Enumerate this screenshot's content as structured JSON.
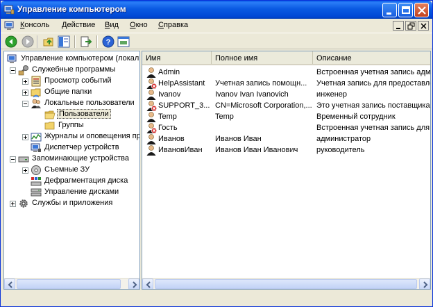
{
  "window": {
    "title": "Управление компьютером"
  },
  "menu": [
    {
      "label": "Консоль"
    },
    {
      "label": "Действие"
    },
    {
      "label": "Вид"
    },
    {
      "label": "Окно"
    },
    {
      "label": "Справка"
    }
  ],
  "tree": {
    "root": "Управление компьютером (локал",
    "system_tools": "Служебные программы",
    "event_viewer": "Просмотр событий",
    "shared_folders": "Общие папки",
    "local_users": "Локальные пользователи",
    "users": "Пользователи",
    "groups": "Группы",
    "perf_logs": "Журналы и оповещения пр",
    "device_manager": "Диспетчер устройств",
    "storage": "Запоминающие устройства",
    "removable": "Съемные ЗУ",
    "defrag": "Дефрагментация диска",
    "disk_mgmt": "Управление дисками",
    "services_apps": "Службы и приложения"
  },
  "list": {
    "columns": [
      "Имя",
      "Полное имя",
      "Описание"
    ],
    "rows": [
      {
        "name": "Admin",
        "full": "",
        "desc": "Встроенная учетная запись адм",
        "disabled": false
      },
      {
        "name": "HelpAssistant",
        "full": "Учетная запись помощн...",
        "desc": "Учетная запись для предоставле",
        "disabled": true
      },
      {
        "name": "Ivanov",
        "full": "Ivanov Ivan Ivanovich",
        "desc": "инженер",
        "disabled": false
      },
      {
        "name": "SUPPORT_3...",
        "full": "CN=Microsoft Corporation,...",
        "desc": "Это учетная запись поставщика",
        "disabled": true
      },
      {
        "name": "Temp",
        "full": "Temp",
        "desc": "Временный сотрудник",
        "disabled": false
      },
      {
        "name": "Гость",
        "full": "",
        "desc": "Встроенная учетная запись для д",
        "disabled": true
      },
      {
        "name": "Иванов",
        "full": "Иванов Иван",
        "desc": "администратор",
        "disabled": false
      },
      {
        "name": "ИвановИван",
        "full": "Иванов Иван Иванович",
        "desc": "руководитель",
        "disabled": false
      }
    ]
  },
  "colors": {
    "titlebar": "#0a5ce6",
    "face": "#ece9d8",
    "pane_border": "#7f9db9"
  }
}
